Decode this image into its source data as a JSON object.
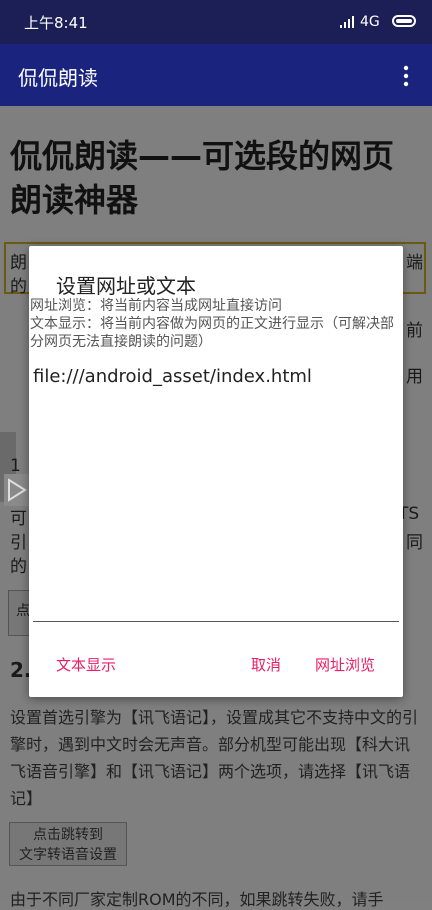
{
  "status_bar": {
    "time": "上午8:41",
    "network": "4G"
  },
  "app_bar": {
    "title": "侃侃朗读"
  },
  "page": {
    "heading": "侃侃朗读——可选段的网页朗读神器",
    "frag_left_1": "朗",
    "frag_left_2": "的",
    "frag_right_1": "端",
    "frag_right_2": "前",
    "frag_right_3": "用",
    "frag_left_3": "1",
    "frag_left_4": "可",
    "frag_left_5": "引",
    "frag_left_6": "的",
    "frag_right_4": "TS",
    "frag_right_5": "同",
    "frag_left_7": "点",
    "section_number": "2.",
    "paragraph": "设置首选引擎为【讯飞语记】，设置成其它不支持中文的引擎时，遇到中文时会无声音。部分机型可能出现【科大讯飞语音引擎】和【讯飞语记】两个选项，请选择【讯飞语记】",
    "tts_button_line1": "点击跳转到",
    "tts_button_line2": "文字转语音设置",
    "bottom_text": "由于不同厂家定制ROM的不同，如果跳转失败，请手"
  },
  "dialog": {
    "title": "设置网址或文本",
    "message_line1": "网址浏览：将当前内容当成网址直接访问",
    "message_line2": "文本显示：将当前内容做为网页的正文进行显示（可解决部分网页无法直接朗读的问题）",
    "input_value": "file:///android_asset/index.html",
    "btn_text_display": "文本显示",
    "btn_cancel": "取消",
    "btn_browse": "网址浏览"
  },
  "colors": {
    "status_bar": "#1b1f55",
    "app_bar": "#1a237e",
    "dialog_accent": "#e91e63"
  }
}
